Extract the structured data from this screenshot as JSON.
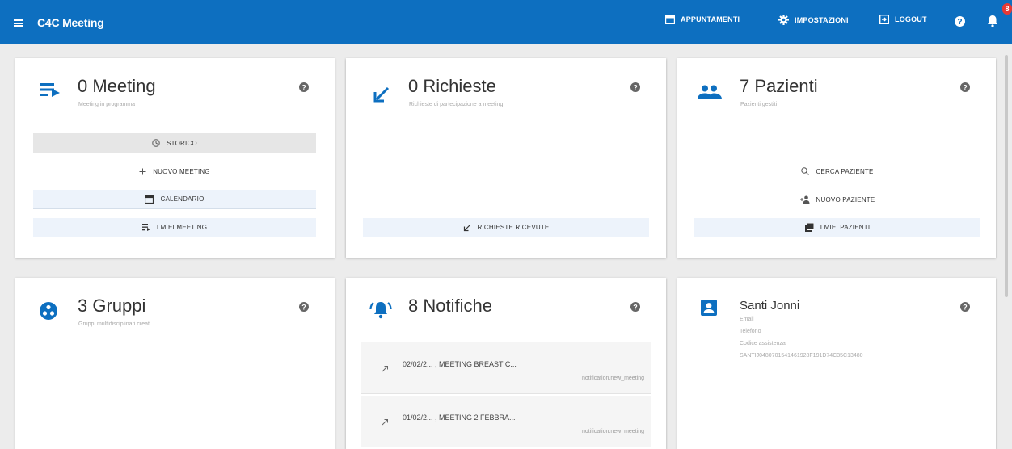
{
  "app": {
    "title": "C4C Meeting"
  },
  "nav": {
    "appuntamenti": "APPUNTAMENTI",
    "impostazioni": "IMPOSTAZIONI",
    "logout": "LOGOUT",
    "badge": "8"
  },
  "colors": {
    "primary": "#0d6fc0",
    "badge": "#e53935"
  },
  "cards": {
    "meeting": {
      "title": "0 Meeting",
      "subtitle": "Meeting in programma",
      "icon": "playlist-play-icon",
      "buttons": {
        "storico": "STORICO",
        "nuovo": "NUOVO MEETING",
        "calendario": "CALENDARIO",
        "miei": "I MIEI MEETING"
      }
    },
    "richieste": {
      "title": "0 Richieste",
      "subtitle": "Richieste di partecipazione a meeting",
      "icon": "arrow-down-left-icon",
      "buttons": {
        "ricevute": "RICHIESTE RICEVUTE"
      }
    },
    "pazienti": {
      "title": "7 Pazienti",
      "subtitle": "Pazienti gestiti",
      "icon": "people-icon",
      "buttons": {
        "cerca": "CERCA PAZIENTE",
        "nuovo": "NUOVO PAZIENTE",
        "miei": "I MIEI PAZIENTI"
      }
    },
    "gruppi": {
      "title": "3 Gruppi",
      "subtitle": "Gruppi multidisciplinari creati",
      "icon": "group-work-icon"
    },
    "notifiche": {
      "title": "8 Notifiche",
      "icon": "bell-ringing-icon",
      "items": [
        {
          "text": "02/02/2... , MEETING BREAST C...",
          "type": "notification.new_meeting"
        },
        {
          "text": "01/02/2... , MEETING 2 FEBBRA...",
          "type": "notification.new_meeting"
        }
      ]
    },
    "profile": {
      "name": "Santi Jonni",
      "email_label": "Email",
      "phone_label": "Telefono",
      "cf_label": "Codice assistenza",
      "cf_value": "SANTIJ0480701541461928F191D74C35C13480",
      "icon": "account-box-icon"
    }
  }
}
